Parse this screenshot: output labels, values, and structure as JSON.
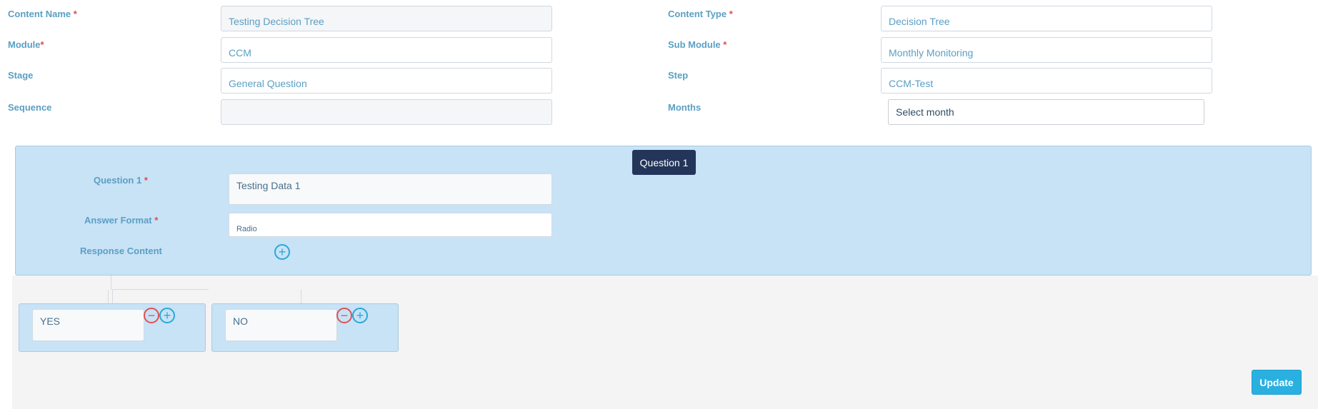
{
  "form": {
    "content_name": {
      "label": "Content Name",
      "value": "Testing Decision Tree"
    },
    "content_type": {
      "label": "Content Type",
      "value": "Decision Tree"
    },
    "module": {
      "label": "Module",
      "value": "CCM"
    },
    "sub_module": {
      "label": "Sub Module",
      "value": "Monthly Monitoring"
    },
    "stage": {
      "label": "Stage",
      "value": "General Question"
    },
    "step": {
      "label": "Step",
      "value": "CCM-Test"
    },
    "sequence": {
      "label": "Sequence",
      "value": ""
    },
    "months": {
      "label": "Months",
      "value": "Select month"
    },
    "required_mark": "*"
  },
  "question": {
    "badge": "Question 1",
    "question_label": "Question 1",
    "question_value": "Testing Data 1",
    "answer_format_label": "Answer Format",
    "answer_format_value": "Radio",
    "response_content_label": "Response Content"
  },
  "answers": [
    {
      "label": "YES"
    },
    {
      "label": "NO"
    }
  ],
  "actions": {
    "update": "Update"
  },
  "icons": {
    "add": "plus-circle-icon",
    "remove": "minus-circle-icon"
  },
  "colors": {
    "accent": "#29b0e0",
    "panel": "#c8e2f6",
    "badge": "#233558",
    "required": "#e24b4b"
  }
}
